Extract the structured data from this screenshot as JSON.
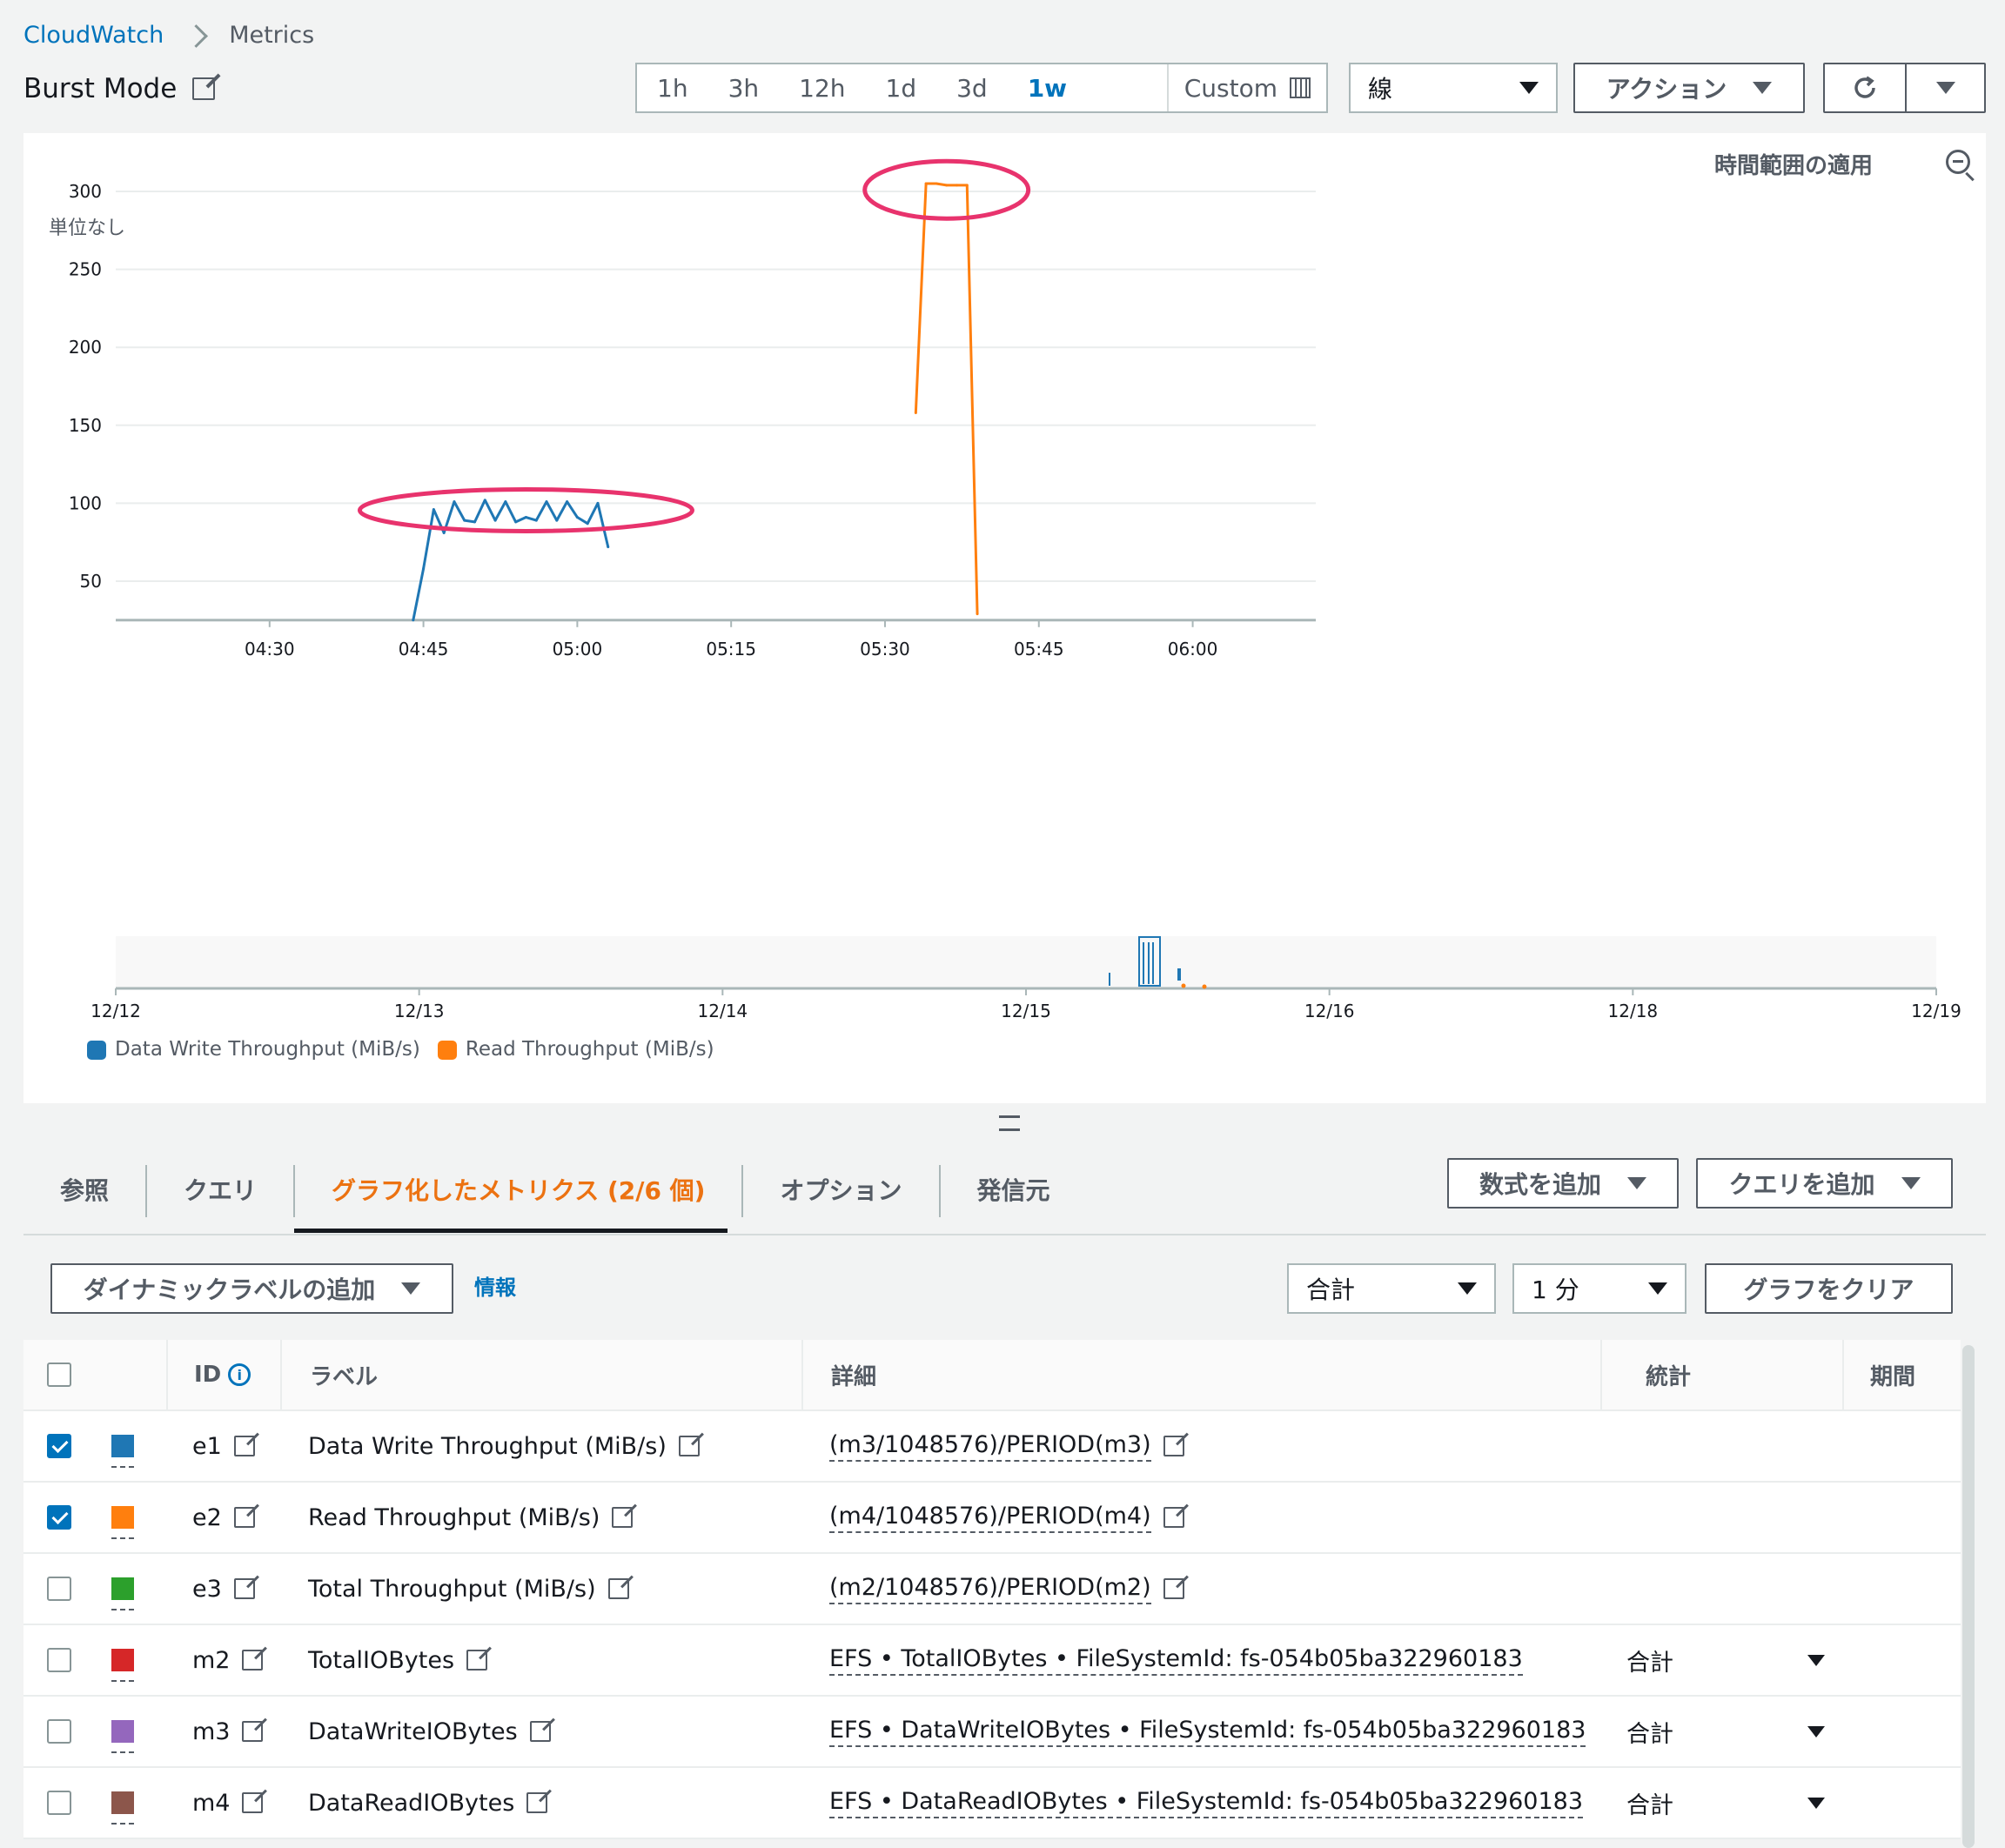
{
  "breadcrumb": {
    "root": "CloudWatch",
    "current": "Metrics"
  },
  "title": "Burst Mode",
  "time_ranges": [
    "1h",
    "3h",
    "12h",
    "1d",
    "3d",
    "1w"
  ],
  "active_time_range": "1w",
  "custom_label": "Custom",
  "chart_type_select": "線",
  "actions_label": "アクション",
  "apply_time_range": "時間範囲の適用",
  "unit_label": "単位なし",
  "colors": {
    "accent": "#0073bb",
    "orange": "#ec7211",
    "highlight": "#e8336d"
  },
  "chart_data": {
    "type": "line",
    "ylabel": "単位なし",
    "ylim": [
      25,
      310
    ],
    "yticks": [
      50,
      100,
      150,
      200,
      250,
      300
    ],
    "xlim": [
      "04:15",
      "06:12"
    ],
    "xticks": [
      "04:30",
      "04:45",
      "05:00",
      "05:15",
      "05:30",
      "05:45",
      "06:00"
    ],
    "overview_xticks": [
      "12/12",
      "12/13",
      "12/14",
      "12/15",
      "12/16",
      "12/18",
      "12/19"
    ],
    "series": [
      {
        "name": "Data Write Throughput (MiB/s)",
        "color": "#1f77b4",
        "x": [
          "04:44",
          "04:45",
          "04:46",
          "04:47",
          "04:48",
          "04:49",
          "04:50",
          "04:51",
          "04:52",
          "04:53",
          "04:54",
          "04:55",
          "04:56",
          "04:57",
          "04:58",
          "04:59",
          "05:00",
          "05:01",
          "05:02",
          "05:03"
        ],
        "y": [
          25,
          58,
          96,
          81,
          101,
          89,
          88,
          102,
          89,
          101,
          88,
          91,
          89,
          101,
          89,
          101,
          91,
          87,
          100,
          72
        ]
      },
      {
        "name": "Read Throughput (MiB/s)",
        "color": "#ff7f0e",
        "x": [
          "05:33",
          "05:34",
          "05:35",
          "05:36",
          "05:37",
          "05:38",
          "05:39"
        ],
        "y": [
          158,
          305,
          305,
          304,
          304,
          304,
          29
        ]
      }
    ]
  },
  "legend": [
    "Data Write Throughput (MiB/s)",
    "Read Throughput (MiB/s)"
  ],
  "tabs": [
    "参照",
    "クエリ",
    "グラフ化したメトリクス (2/6 個)",
    "オプション",
    "発信元"
  ],
  "add_math": "数式を追加",
  "add_query": "クエリを追加",
  "dynamic_label": "ダイナミックラベルの追加",
  "info": "情報",
  "stat_select": "合計",
  "period_select": "1 分",
  "clear_graph": "グラフをクリア",
  "table": {
    "headers": {
      "id": "ID",
      "label": "ラベル",
      "details": "詳細",
      "stat": "統計",
      "period": "期間"
    },
    "rows": [
      {
        "checked": true,
        "color": "#1f77b4",
        "id": "e1",
        "label": "Data Write Throughput (MiB/s)",
        "details": "(m3/1048576)/PERIOD(m3)",
        "stat": ""
      },
      {
        "checked": true,
        "color": "#ff7f0e",
        "id": "e2",
        "label": "Read Throughput (MiB/s)",
        "details": "(m4/1048576)/PERIOD(m4)",
        "stat": ""
      },
      {
        "checked": false,
        "color": "#2ca02c",
        "id": "e3",
        "label": "Total Throughput (MiB/s)",
        "details": "(m2/1048576)/PERIOD(m2)",
        "stat": ""
      },
      {
        "checked": false,
        "color": "#d62728",
        "id": "m2",
        "label": "TotalIOBytes",
        "details": "EFS • TotalIOBytes • FileSystemId: fs-054b05ba322960183",
        "stat": "合計"
      },
      {
        "checked": false,
        "color": "#9467bd",
        "id": "m3",
        "label": "DataWriteIOBytes",
        "details": "EFS • DataWriteIOBytes • FileSystemId: fs-054b05ba322960183",
        "stat": "合計"
      },
      {
        "checked": false,
        "color": "#8c564b",
        "id": "m4",
        "label": "DataReadIOBytes",
        "details": "EFS • DataReadIOBytes • FileSystemId: fs-054b05ba322960183",
        "stat": "合計"
      }
    ]
  }
}
